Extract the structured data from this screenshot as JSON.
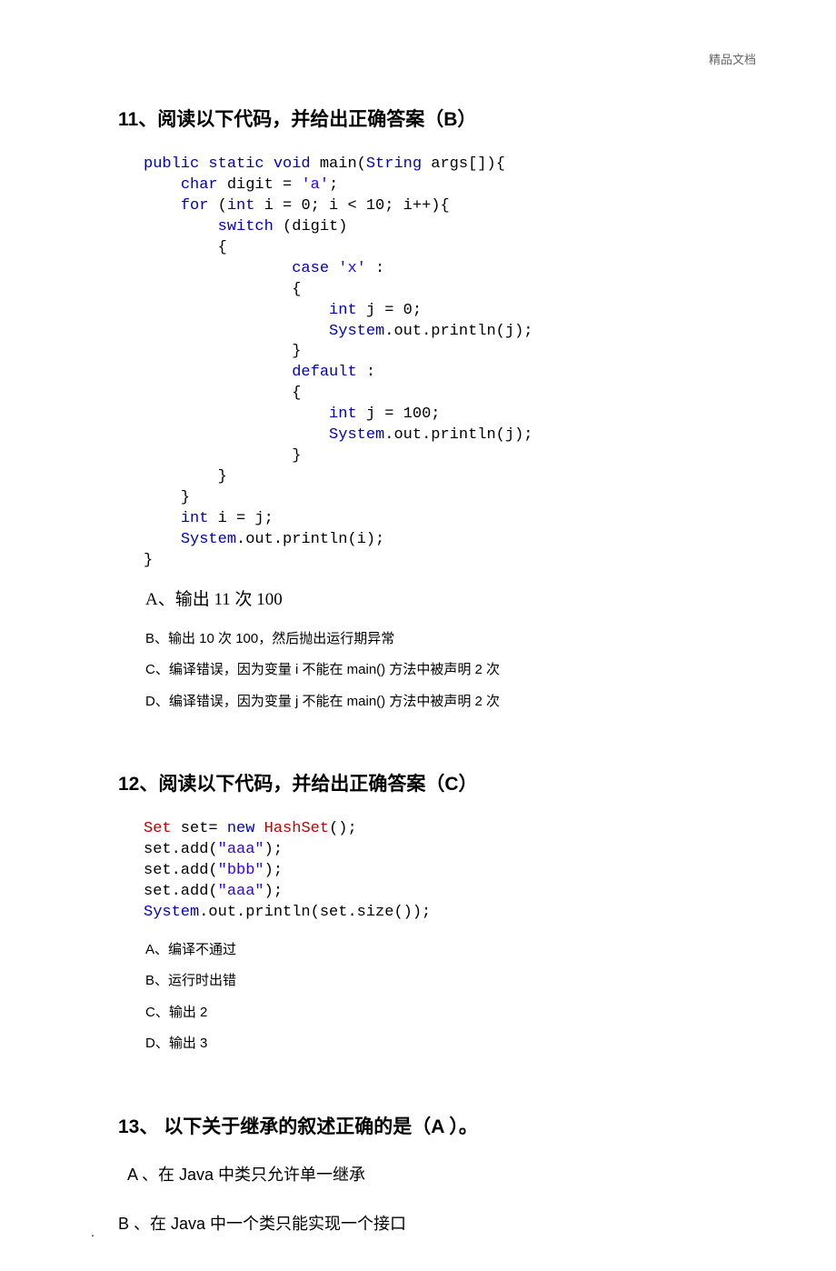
{
  "header": {
    "label": "精品文档"
  },
  "footer": {
    "dot": "."
  },
  "q11": {
    "heading": "11、阅读以下代码，并给出正确答案（B）",
    "code_lines": [
      "public static void main(String args[]){",
      "    char digit = 'a';",
      "    for (int i = 0; i < 10; i++){",
      "        switch (digit)",
      "        {",
      "                case 'x' :",
      "                {",
      "                    int j = 0;",
      "                    System.out.println(j);",
      "                }",
      "                default :",
      "                {",
      "                    int j = 100;",
      "                    System.out.println(j);",
      "                }",
      "        }",
      "    }",
      "    int i = j;",
      "    System.out.println(i);",
      "}"
    ],
    "options": [
      "A、输出 11 次 100",
      "B、输出 10 次 100，然后抛出运行期异常",
      "C、编译错误，因为变量 i 不能在 main()  方法中被声明 2 次",
      "D、编译错误，因为变量 j 不能在 main()  方法中被声明 2 次"
    ]
  },
  "q12": {
    "heading": "12、阅读以下代码，并给出正确答案（C）",
    "code_lines": [
      "Set set= new HashSet();",
      "set.add(\"aaa\");",
      "set.add(\"bbb\");",
      "set.add(\"aaa\");",
      "System.out.println(set.size());"
    ],
    "options": [
      "A、编译不通过",
      "B、运行时出错",
      "C、输出 2",
      "D、输出 3"
    ]
  },
  "q13": {
    "heading": "13、 以下关于继承的叙述正确的是（A  ）。",
    "options": [
      "A  、在 Java  中类只允许单一继承",
      "B  、在 Java  中一个类只能实现一个接口"
    ]
  }
}
